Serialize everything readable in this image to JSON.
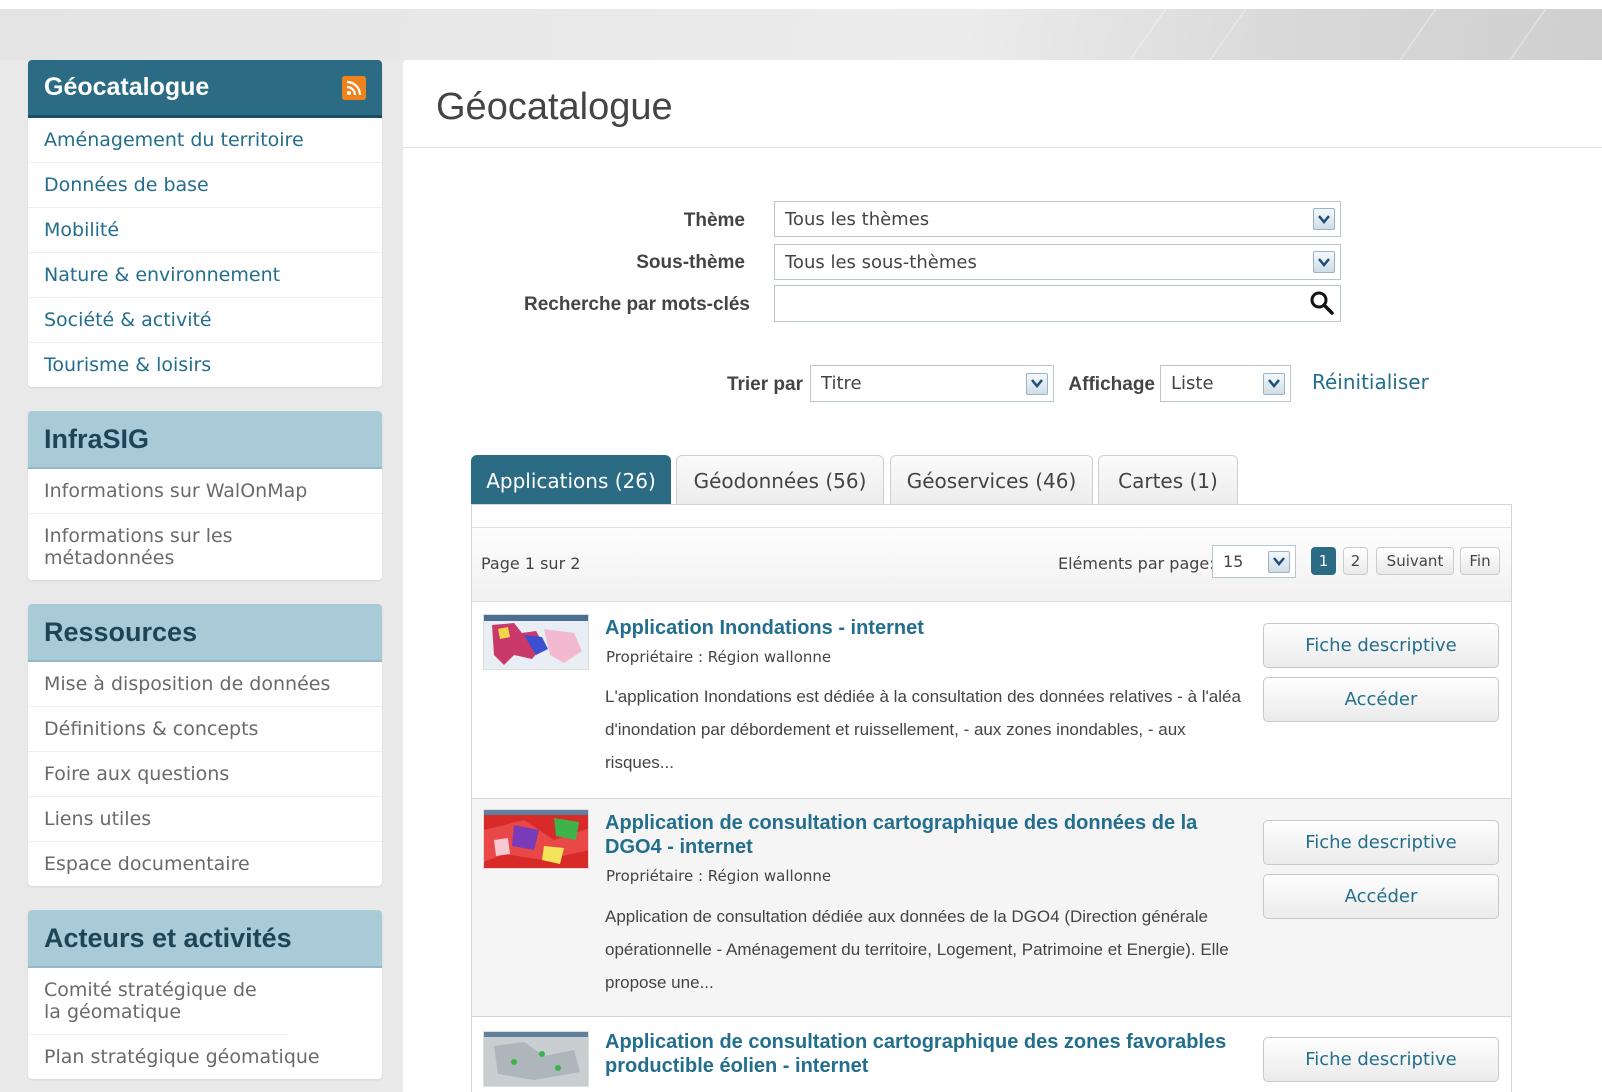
{
  "sidebar": {
    "geocatalogue": {
      "title": "Géocatalogue",
      "items": [
        "Aménagement du territoire",
        "Données de base",
        "Mobilité",
        "Nature & environnement",
        "Société & activité",
        "Tourisme & loisirs"
      ]
    },
    "infrasig": {
      "title": "InfraSIG",
      "items": [
        "Informations sur WalOnMap",
        "Informations sur les métadonnées"
      ]
    },
    "ressources": {
      "title": "Ressources",
      "items": [
        "Mise à disposition de données",
        "Définitions & concepts",
        "Foire aux questions",
        "Liens utiles",
        "Espace documentaire"
      ]
    },
    "acteurs": {
      "title": "Acteurs et activités",
      "items": [
        "Comité stratégique de la géomatique",
        "Plan stratégique géomatique"
      ]
    }
  },
  "main": {
    "title": "Géocatalogue",
    "filters": {
      "theme_label": "Thème",
      "theme_value": "Tous les thèmes",
      "subtheme_label": "Sous-thème",
      "subtheme_value": "Tous les sous-thèmes",
      "keywords_label": "Recherche par mots-clés",
      "keywords_value": "",
      "sort_label": "Trier par",
      "sort_value": "Titre",
      "display_label": "Affichage",
      "display_value": "Liste",
      "reset_label": "Réinitialiser"
    },
    "tabs": [
      "Applications (26)",
      "Géodonnées (56)",
      "Géoservices (46)",
      "Cartes (1)"
    ],
    "pager": {
      "page_text": "Page 1 sur 2",
      "per_page_label": "Eléments par page:",
      "per_page_value": "15",
      "pages": [
        "1",
        "2"
      ],
      "next_label": "Suivant",
      "end_label": "Fin"
    },
    "results": [
      {
        "title": "Application Inondations - internet",
        "owner": "Propriétaire : Région wallonne",
        "description": "L'application Inondations est dédiée à la consultation des données relatives - à l'aléa d'inondation par débordement et ruissellement, - aux zones inondables, - aux risques...",
        "btn_fiche": "Fiche descriptive",
        "btn_acceder": "Accéder"
      },
      {
        "title": "Application de consultation cartographique des données de la DGO4 - internet",
        "owner": "Propriétaire : Région wallonne",
        "description": "Application de consultation dédiée aux données de la DGO4 (Direction générale opérationnelle - Aménagement du territoire, Logement, Patrimoine et Energie). Elle propose une...",
        "btn_fiche": "Fiche descriptive",
        "btn_acceder": "Accéder"
      },
      {
        "title": "Application de consultation cartographique des zones favorables productible éolien - internet",
        "btn_fiche": "Fiche descriptive"
      }
    ]
  },
  "colors": {
    "primary": "#2b6b84",
    "link": "#236e8c",
    "header_light": "#a9cbd8",
    "rss": "#f0821e"
  }
}
